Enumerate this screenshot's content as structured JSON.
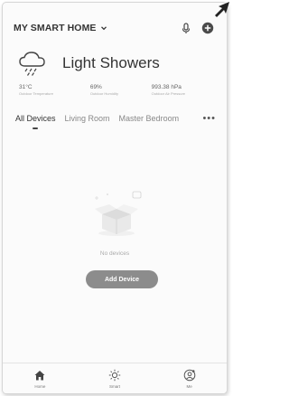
{
  "header": {
    "home_name": "MY SMART HOME",
    "icons": [
      "chevron-down-icon",
      "microphone-icon",
      "add-circle-icon"
    ]
  },
  "weather": {
    "condition": "Light Showers",
    "icon": "cloud-rain-icon",
    "stats": [
      {
        "value": "31°C",
        "label": "Outdoor Temperature"
      },
      {
        "value": "69%",
        "label": "Outdoor Humidity"
      },
      {
        "value": "993.38 hPa",
        "label": "Outdoor Air Pressure"
      }
    ]
  },
  "rooms": {
    "tabs": [
      "All Devices",
      "Living Room",
      "Master Bedroom"
    ],
    "more": "•••"
  },
  "empty": {
    "message": "No devices",
    "add_button": "Add Device"
  },
  "tabbar": {
    "items": [
      {
        "label": "Home",
        "icon": "home-icon"
      },
      {
        "label": "Smart",
        "icon": "sun-icon"
      },
      {
        "label": "Me",
        "icon": "profile-icon"
      }
    ]
  },
  "colors": {
    "accent": "#8c8c8c",
    "text": "#333333"
  }
}
